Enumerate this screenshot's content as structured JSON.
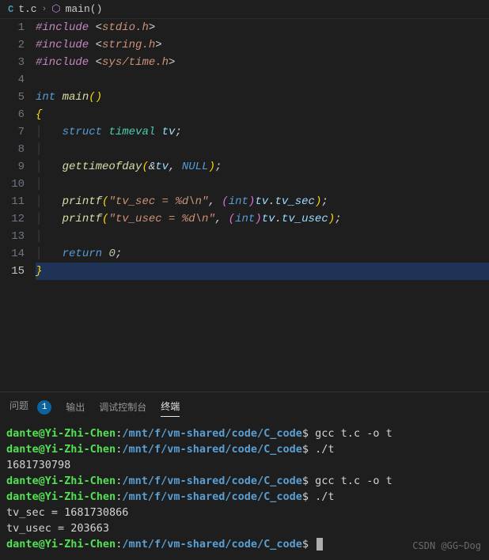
{
  "breadcrumb": {
    "file_icon_label": "C",
    "file": "t.c",
    "symbol": "main()"
  },
  "editor": {
    "active_line": 15,
    "lines": [
      {
        "n": 1,
        "seg": [
          [
            "pp",
            "#include"
          ],
          [
            "punc",
            " "
          ],
          [
            "punc",
            "<"
          ],
          [
            "str",
            "stdio.h"
          ],
          [
            "punc",
            ">"
          ]
        ]
      },
      {
        "n": 2,
        "seg": [
          [
            "pp",
            "#include"
          ],
          [
            "punc",
            " "
          ],
          [
            "punc",
            "<"
          ],
          [
            "str",
            "string.h"
          ],
          [
            "punc",
            ">"
          ]
        ]
      },
      {
        "n": 3,
        "seg": [
          [
            "pp",
            "#include"
          ],
          [
            "punc",
            " "
          ],
          [
            "punc",
            "<"
          ],
          [
            "str",
            "sys/time.h"
          ],
          [
            "punc",
            ">"
          ]
        ]
      },
      {
        "n": 4,
        "seg": []
      },
      {
        "n": 5,
        "seg": [
          [
            "kw",
            "int"
          ],
          [
            "punc",
            " "
          ],
          [
            "fn",
            "main"
          ],
          [
            "paren",
            "()"
          ]
        ]
      },
      {
        "n": 6,
        "seg": [
          [
            "brace",
            "{"
          ]
        ]
      },
      {
        "n": 7,
        "seg": [
          [
            "guide",
            "│   "
          ],
          [
            "kw",
            "struct"
          ],
          [
            "punc",
            " "
          ],
          [
            "type",
            "timeval"
          ],
          [
            "punc",
            " "
          ],
          [
            "var",
            "tv"
          ],
          [
            "punc",
            ";"
          ]
        ]
      },
      {
        "n": 8,
        "seg": [
          [
            "guide",
            "│"
          ]
        ]
      },
      {
        "n": 9,
        "seg": [
          [
            "guide",
            "│   "
          ],
          [
            "fn",
            "gettimeofday"
          ],
          [
            "paren",
            "("
          ],
          [
            "op",
            "&"
          ],
          [
            "var",
            "tv"
          ],
          [
            "punc",
            ", "
          ],
          [
            "const",
            "NULL"
          ],
          [
            "paren",
            ")"
          ],
          [
            "punc",
            ";"
          ]
        ]
      },
      {
        "n": 10,
        "seg": [
          [
            "guide",
            "│"
          ]
        ]
      },
      {
        "n": 11,
        "seg": [
          [
            "guide",
            "│   "
          ],
          [
            "fn",
            "printf"
          ],
          [
            "paren",
            "("
          ],
          [
            "str",
            "\"tv_sec = %d\\n\""
          ],
          [
            "punc",
            ", "
          ],
          [
            "paren2",
            "("
          ],
          [
            "kw",
            "int"
          ],
          [
            "paren2",
            ")"
          ],
          [
            "var",
            "tv"
          ],
          [
            "punc",
            "."
          ],
          [
            "var",
            "tv_sec"
          ],
          [
            "paren",
            ")"
          ],
          [
            "punc",
            ";"
          ]
        ]
      },
      {
        "n": 12,
        "seg": [
          [
            "guide",
            "│   "
          ],
          [
            "fn",
            "printf"
          ],
          [
            "paren",
            "("
          ],
          [
            "str",
            "\"tv_usec = %d\\n\""
          ],
          [
            "punc",
            ", "
          ],
          [
            "paren2",
            "("
          ],
          [
            "kw",
            "int"
          ],
          [
            "paren2",
            ")"
          ],
          [
            "var",
            "tv"
          ],
          [
            "punc",
            "."
          ],
          [
            "var",
            "tv_usec"
          ],
          [
            "paren",
            ")"
          ],
          [
            "punc",
            ";"
          ]
        ]
      },
      {
        "n": 13,
        "seg": [
          [
            "guide",
            "│"
          ]
        ]
      },
      {
        "n": 14,
        "seg": [
          [
            "guide",
            "│   "
          ],
          [
            "kw",
            "return"
          ],
          [
            "punc",
            " "
          ],
          [
            "num",
            "0"
          ],
          [
            "punc",
            ";"
          ]
        ]
      },
      {
        "n": 15,
        "seg": [
          [
            "brace",
            "}"
          ]
        ],
        "hl": true
      }
    ]
  },
  "panel": {
    "tabs": {
      "problems": "问题",
      "problems_count": "1",
      "output": "输出",
      "debug": "调试控制台",
      "terminal": "终端"
    }
  },
  "terminal": {
    "user": "dante",
    "host": "Yi-Zhi-Chen",
    "path": "/mnt/f/vm-shared/code/C_code",
    "lines": [
      {
        "type": "prompt",
        "cmd": "gcc t.c -o t"
      },
      {
        "type": "prompt",
        "cmd": "./t"
      },
      {
        "type": "out",
        "text": "1681730798"
      },
      {
        "type": "prompt",
        "cmd": "gcc t.c -o t"
      },
      {
        "type": "prompt",
        "cmd": "./t"
      },
      {
        "type": "out",
        "text": "tv_sec = 1681730866"
      },
      {
        "type": "out",
        "text": "tv_usec = 203663"
      },
      {
        "type": "prompt",
        "cmd": "",
        "cursor": true
      }
    ],
    "watermark": "CSDN @GG~Dog"
  }
}
